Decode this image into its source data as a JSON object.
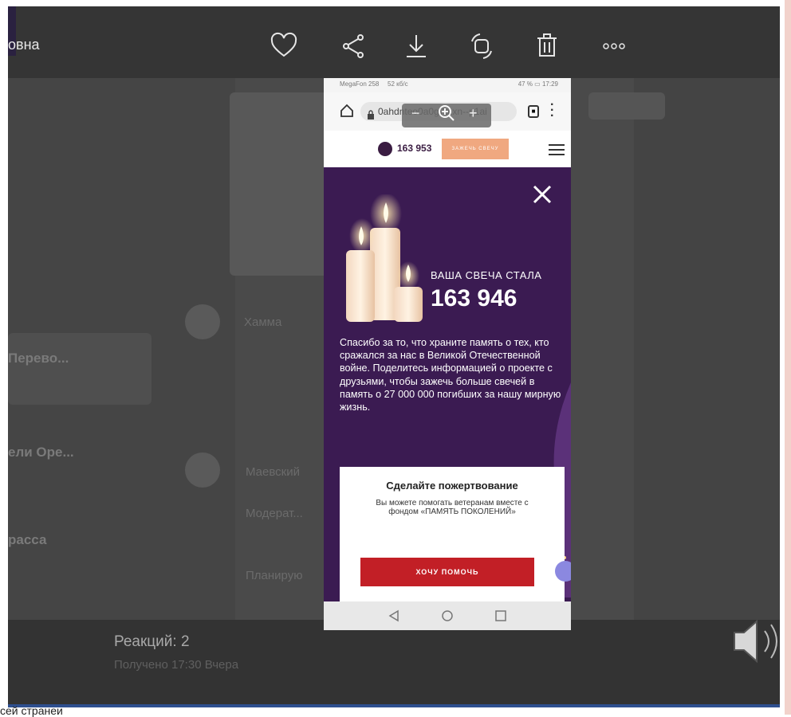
{
  "viewer": {
    "sender_name": "овна",
    "toolbar": {
      "like": "heart-icon",
      "share": "share-icon",
      "download": "download-icon",
      "rotate": "rotate-icon",
      "delete": "trash-icon",
      "more": "more-icon"
    },
    "background_blur": {
      "items": [
        "Перево...",
        "ели Оре...",
        "расса",
        "Хамма",
        "Маевский",
        "Модерат...",
        "Планирую"
      ]
    },
    "reactions": "Реакций: 2",
    "received": "Получено 17:30 Вчера",
    "footer_text": "сей странеи"
  },
  "phone": {
    "status": {
      "carrier": "MegaFon 258",
      "speed": "52 кб/с",
      "battery": "47 %",
      "time": "17:29"
    },
    "url": "0ahdnteo0a0g7a.xn--p1ai",
    "zoom": {
      "minus": "−",
      "plus": "+"
    },
    "site": {
      "counter": "163 953",
      "light_button": "ЗАЖЕЧЬ СВЕЧУ"
    },
    "modal": {
      "candle_became": "ВАША СВЕЧА СТАЛА",
      "candle_number": "163 946",
      "thanks_text": "Спасибо за то, что храните память о тех, кто сражался за нас в Великой Отечественной войне. Поделитесь информацией о проекте с друзьями, чтобы зажечь больше свечей в память о 27 000 000 погибших за нашу мирную жизнь.",
      "donate_title": "Сделайте пожертвование",
      "donate_text": "Вы можете помогать ветеранам вместе с фондом «ПАМЯТЬ ПОКОЛЕНИЙ»",
      "help_button": "ХОЧУ ПОМОЧЬ"
    }
  },
  "colors": {
    "modal_bg": "#3b1b52",
    "help_button": "#c21f26",
    "light_button": "#f0a880",
    "viewer_bg": "#3d3d3d"
  }
}
